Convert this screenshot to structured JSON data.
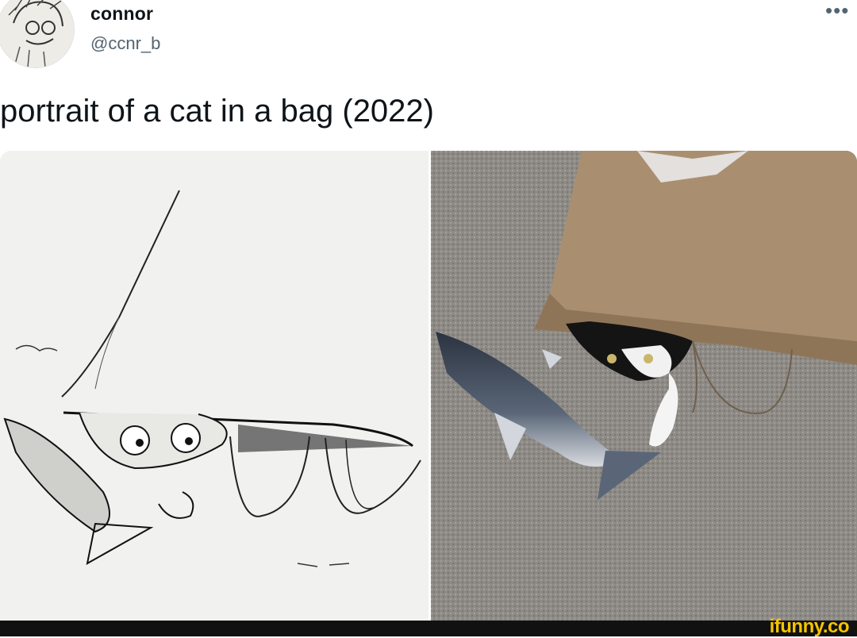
{
  "tweet": {
    "author_name": "connor",
    "author_handle": "@ccnr_b",
    "more_icon": "more-horizontal-icon",
    "text": "portrait of a cat in a bag (2022)"
  },
  "media": {
    "left_image": "pen-sketch-cat-in-paper-bag-with-fish-toy",
    "right_image": "photo-tuxedo-cat-in-paper-bag-with-fish-toy"
  },
  "watermark": {
    "text": "ifunny.co"
  },
  "colors": {
    "text_primary": "#0f1419",
    "text_secondary": "#536471",
    "watermark": "#f6c400",
    "footer_bar": "#111111"
  }
}
